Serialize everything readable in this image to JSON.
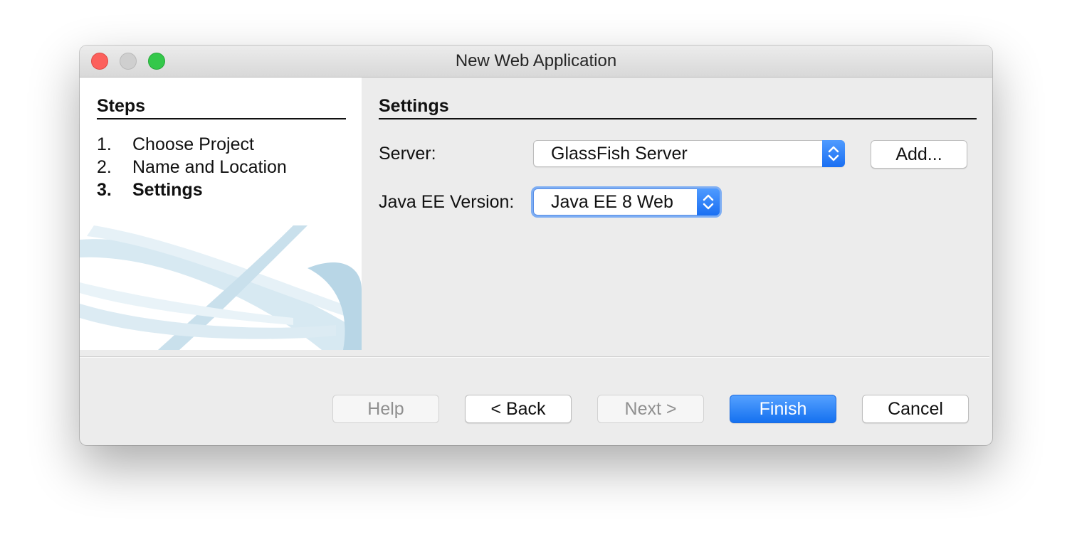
{
  "window": {
    "title": "New Web Application"
  },
  "steps": {
    "heading": "Steps",
    "items": [
      {
        "num": "1.",
        "label": "Choose Project"
      },
      {
        "num": "2.",
        "label": "Name and Location"
      },
      {
        "num": "3.",
        "label": "Settings"
      }
    ],
    "current_index": 2
  },
  "settings": {
    "heading": "Settings",
    "server_label": "Server:",
    "server_value": "GlassFish Server",
    "add_button": "Add...",
    "javaee_label": "Java EE Version:",
    "javaee_value": "Java EE 8 Web"
  },
  "buttons": {
    "help": "Help",
    "back": "< Back",
    "next": "Next >",
    "finish": "Finish",
    "cancel": "Cancel"
  },
  "colors": {
    "accent": "#1a6ff2",
    "close": "#fc605c",
    "maximize": "#34c84a",
    "minimize": "#cfcfcf"
  },
  "icons": [
    "close-traffic-light",
    "minimize-traffic-light",
    "maximize-traffic-light",
    "up-down-chevron-icon"
  ]
}
